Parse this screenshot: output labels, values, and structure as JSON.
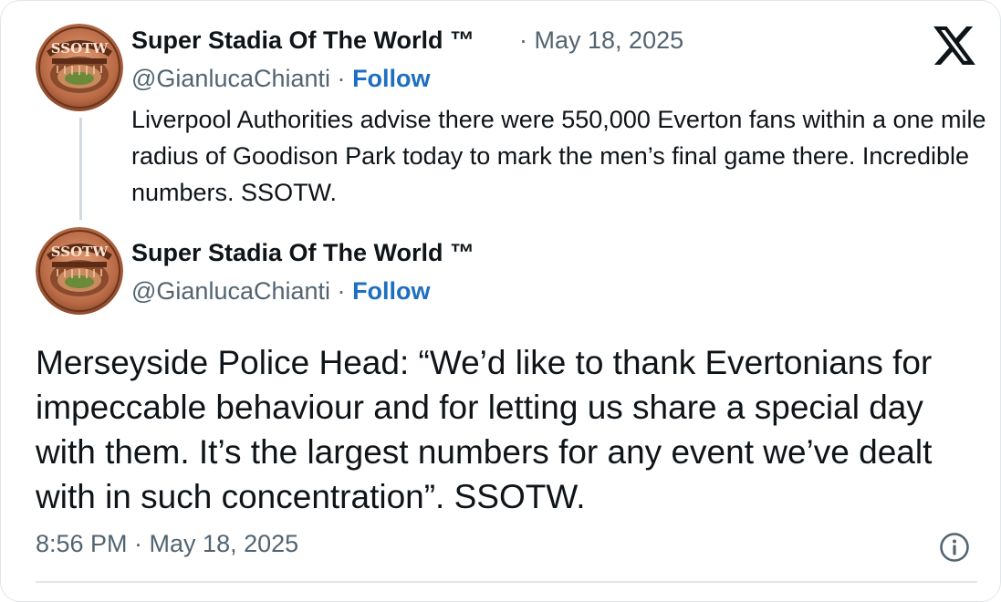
{
  "reply_tweet": {
    "author_name": "Super Stadia Of The World ™",
    "separator": "·",
    "date": "May 18, 2025",
    "handle": "@GianlucaChianti",
    "follow_label": "Follow",
    "text": "Liverpool Authorities advise there were 550,000 Everton fans within a one mile radius of Goodison Park today to mark the men’s final game there. Incredible numbers. SSOTW."
  },
  "main_tweet": {
    "author_name": "Super Stadia Of The World ™",
    "separator": "·",
    "handle": "@GianlucaChianti",
    "follow_label": "Follow",
    "text": "Merseyside Police Head: “We’d like to thank Evertonians for impeccable behaviour and for letting us share a special day with them. It’s the largest numbers for any event we’ve dealt with in such concentration”. SSOTW.",
    "timestamp": "8:56 PM · May 18, 2025"
  },
  "avatar": {
    "logo_text": "SSOTW"
  },
  "icons": {
    "brand": "x-logo-icon",
    "info": "info-icon"
  },
  "colors": {
    "text_primary": "#0f1419",
    "text_secondary": "#536471",
    "link": "#1d6fbf",
    "border": "#e1e6ea",
    "thread_line": "#cfd9de"
  }
}
